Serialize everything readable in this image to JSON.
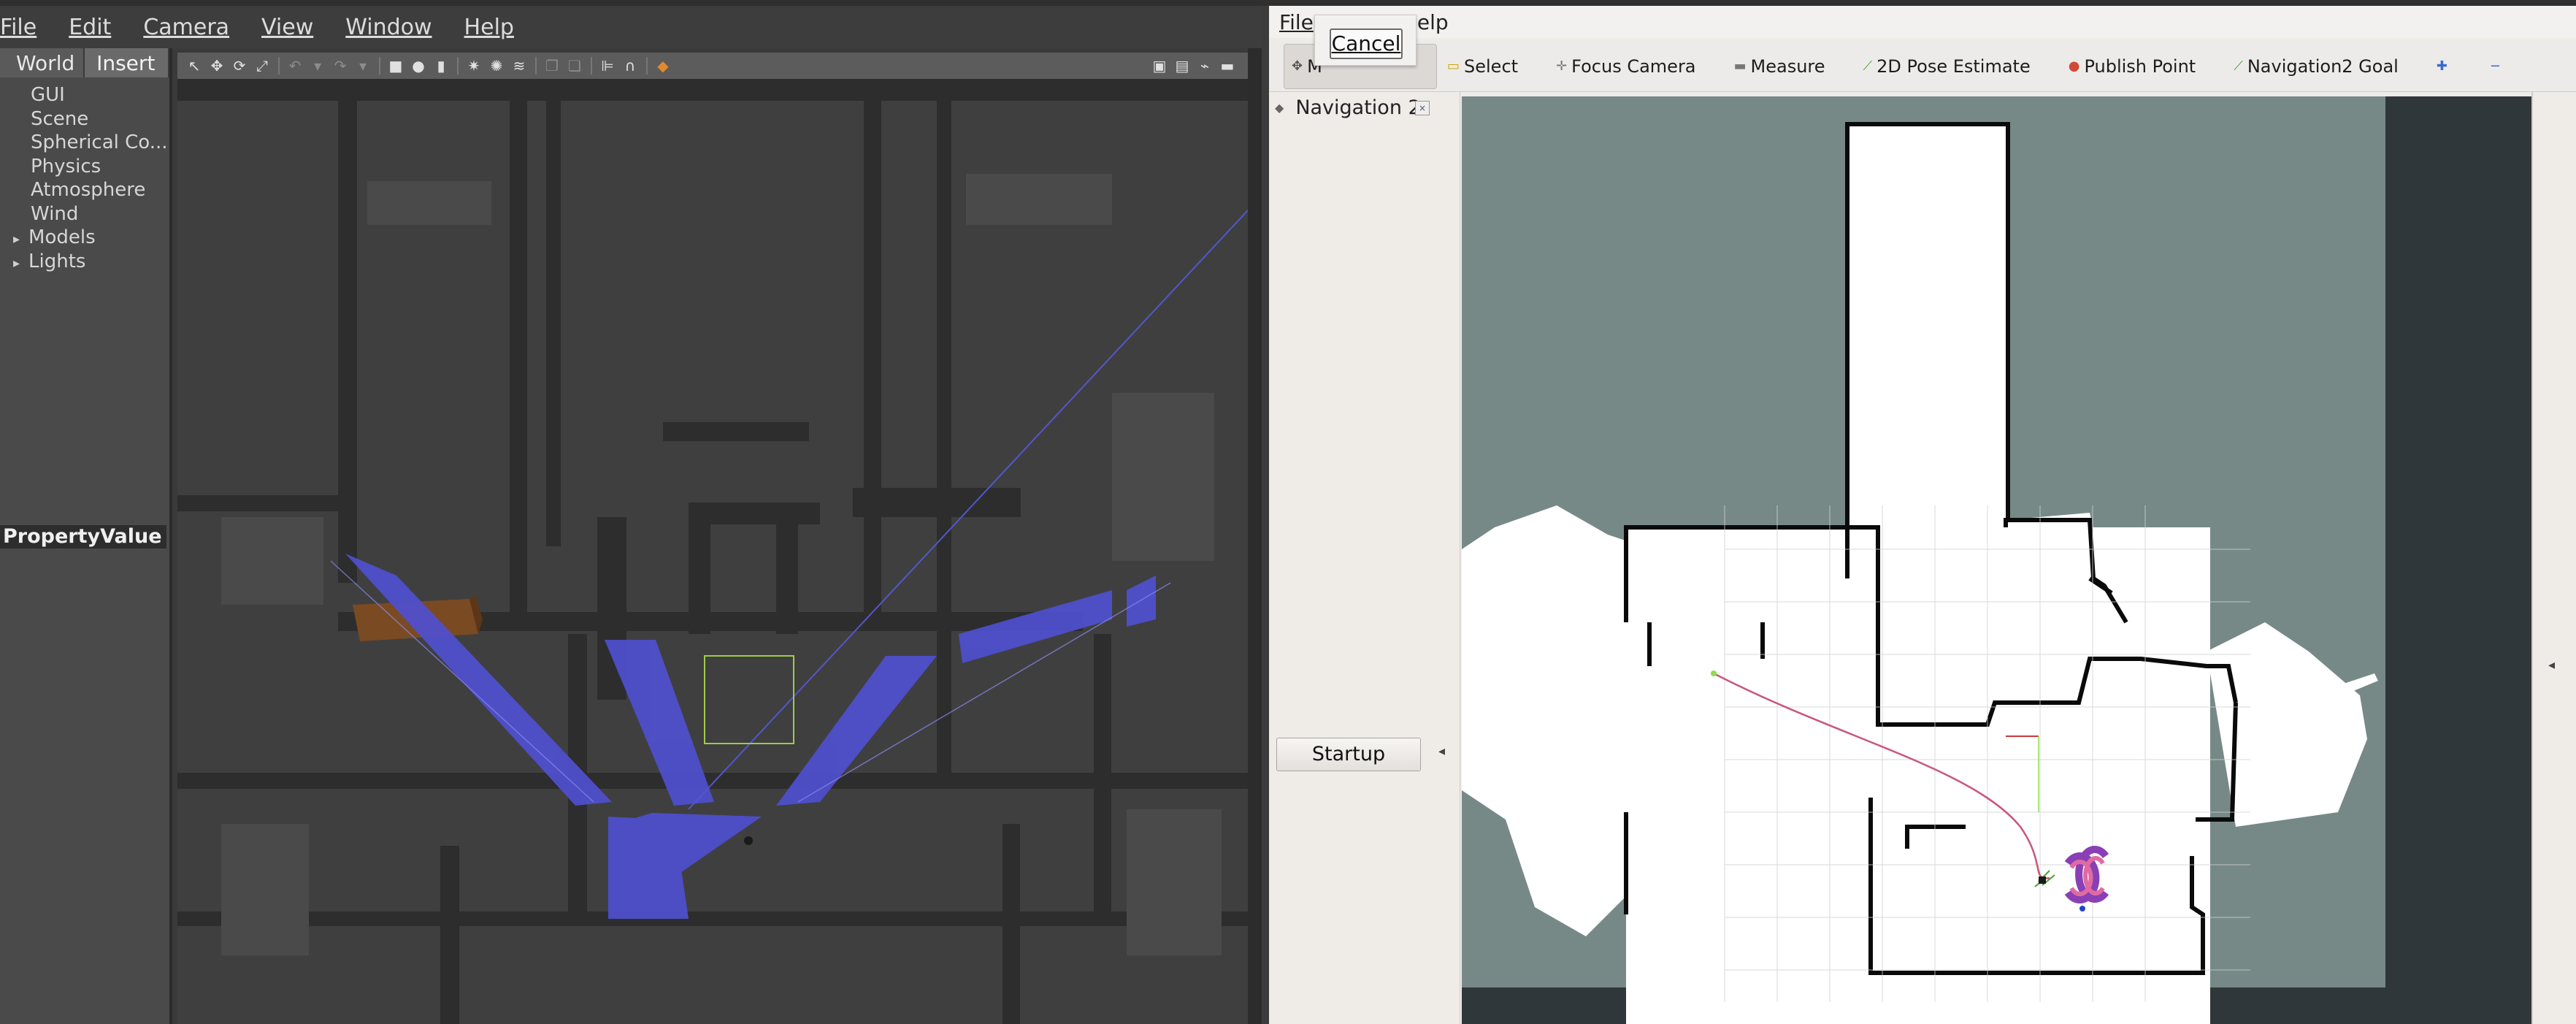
{
  "gazebo": {
    "menu": [
      "File",
      "Edit",
      "Camera",
      "View",
      "Window",
      "Help"
    ],
    "tabs": {
      "world": "World",
      "insert": "Insert"
    },
    "tree": [
      "GUI",
      "Scene",
      "Spherical Co...",
      "Physics",
      "Atmosphere",
      "Wind"
    ],
    "tree_expandable": [
      "Models",
      "Lights"
    ],
    "property_header": "PropertyValue",
    "toolbar_icons": [
      "select-mode-icon",
      "translate-icon",
      "rotate-icon",
      "scale-icon",
      "undo-icon",
      "redo-icon",
      "box-icon",
      "sphere-icon",
      "cylinder-icon",
      "point-light-icon",
      "spot-light-icon",
      "directional-light-icon",
      "copy-icon",
      "paste-icon",
      "align-icon",
      "snap-icon",
      "change-view-icon",
      "screenshot-icon",
      "log-icon",
      "plot-icon",
      "video-icon"
    ]
  },
  "rviz": {
    "menu": {
      "file": "File",
      "help": "elp"
    },
    "toolbar": {
      "move_camera": "M",
      "select": "Select",
      "focus_camera": "Focus Camera",
      "measure": "Measure",
      "pose_estimate": "2D Pose Estimate",
      "publish_point": "Publish Point",
      "nav_goal": "Navigation2 Goal"
    },
    "panel_title": "Navigation 2",
    "startup_button": "Startup",
    "cancel_button": "Cancel"
  },
  "colors": {
    "laser_blue": "#4f4fd0",
    "map_free": "#ffffff",
    "map_unknown": "#778987",
    "path": "#c8587a",
    "costmap_purple": "#8a3fb5"
  }
}
